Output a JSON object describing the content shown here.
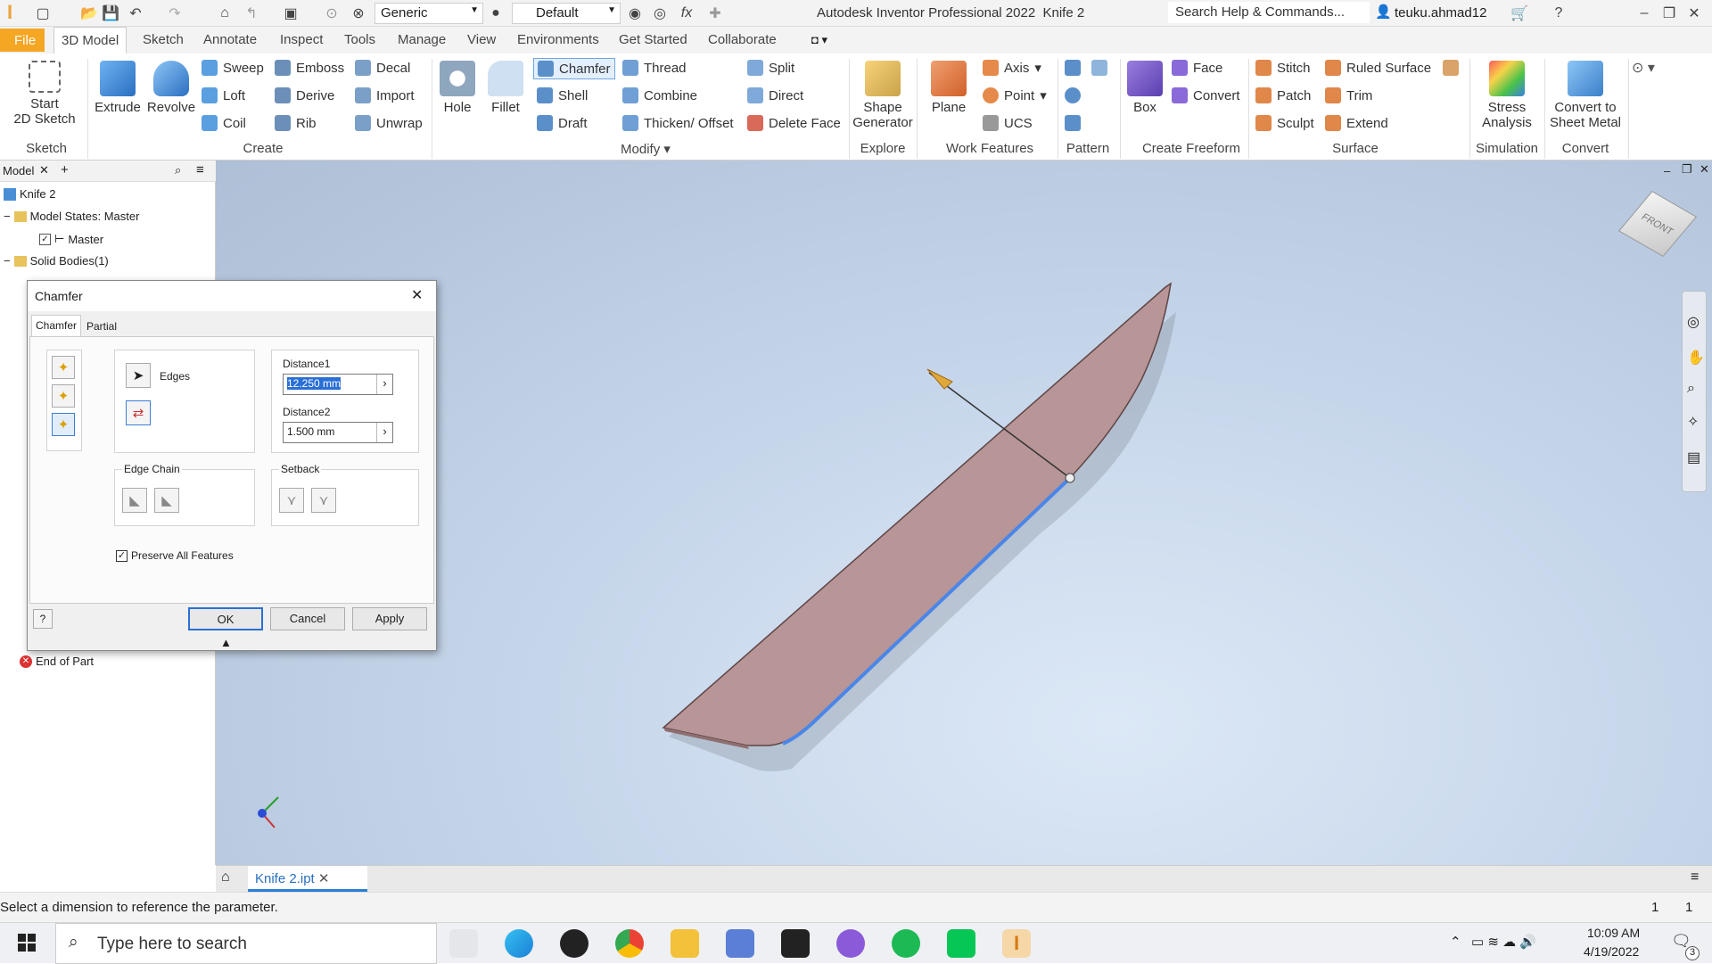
{
  "app": {
    "title": "Autodesk Inventor Professional 2022",
    "doc": "Knife 2",
    "search_placeholder": "Search Help & Commands...",
    "user": "teuku.ahmad12",
    "material": "Generic",
    "appearance": "Default",
    "formula": "fx"
  },
  "tabs": [
    "File",
    "3D Model",
    "Sketch",
    "Annotate",
    "Inspect",
    "Tools",
    "Manage",
    "View",
    "Environments",
    "Get Started",
    "Collaborate"
  ],
  "ribbon": {
    "sketch": {
      "start_label": "Start",
      "start_label2": "2D Sketch",
      "group": "Sketch"
    },
    "create": {
      "extrude": "Extrude",
      "revolve": "Revolve",
      "sweep": "Sweep",
      "loft": "Loft",
      "coil": "Coil",
      "emboss": "Emboss",
      "derive": "Derive",
      "rib": "Rib",
      "decal": "Decal",
      "import": "Import",
      "unwrap": "Unwrap",
      "group": "Create"
    },
    "modify": {
      "hole": "Hole",
      "fillet": "Fillet",
      "chamfer": "Chamfer",
      "shell": "Shell",
      "draft": "Draft",
      "thread": "Thread",
      "combine": "Combine",
      "thicken": "Thicken/ Offset",
      "split": "Split",
      "direct": "Direct",
      "delete_face": "Delete Face",
      "group": "Modify"
    },
    "explore": {
      "shape1": "Shape",
      "shape2": "Generator",
      "group": "Explore"
    },
    "work": {
      "plane": "Plane",
      "axis": "Axis",
      "point": "Point",
      "ucs": "UCS",
      "group": "Work Features"
    },
    "pattern": {
      "group": "Pattern"
    },
    "freeform": {
      "box": "Box",
      "face": "Face",
      "convert": "Convert",
      "group": "Create Freeform"
    },
    "surface": {
      "stitch": "Stitch",
      "patch": "Patch",
      "sculpt": "Sculpt",
      "ruled": "Ruled Surface",
      "trim": "Trim",
      "extend": "Extend",
      "group": "Surface"
    },
    "simulation": {
      "stress1": "Stress",
      "stress2": "Analysis",
      "group": "Simulation"
    },
    "convert": {
      "c1": "Convert to",
      "c2": "Sheet Metal",
      "group": "Convert"
    }
  },
  "browser": {
    "tab": "Model",
    "items": [
      "Knife 2",
      "Model States: Master",
      "Master",
      "Solid Bodies(1)",
      "End of Part"
    ]
  },
  "dialog": {
    "title": "Chamfer",
    "tab1": "Chamfer",
    "tab2": "Partial",
    "edges": "Edges",
    "d1_label": "Distance1",
    "d1": "12.250 mm",
    "d2_label": "Distance2",
    "d2": "1.500 mm",
    "edge_chain": "Edge Chain",
    "setback": "Setback",
    "preserve": "Preserve All Features",
    "ok": "OK",
    "cancel": "Cancel",
    "apply": "Apply"
  },
  "viewcube": "FRONT",
  "doc_tab": "Knife 2.ipt",
  "status": {
    "msg": "Select a dimension to reference the parameter.",
    "n1": "1",
    "n2": "1"
  },
  "taskbar": {
    "search": "Type here to search",
    "time": "10:09 AM",
    "date": "4/19/2022",
    "notif": "3"
  }
}
